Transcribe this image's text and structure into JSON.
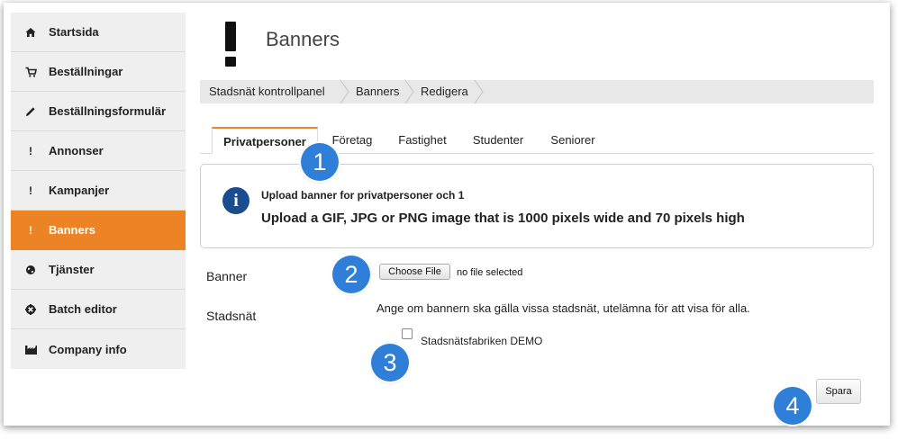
{
  "sidebar": {
    "items": [
      {
        "label": "Startsida",
        "icon": "home-icon"
      },
      {
        "label": "Beställningar",
        "icon": "cart-icon"
      },
      {
        "label": "Beställningsformulär",
        "icon": "pencil-icon"
      },
      {
        "label": "Annonser",
        "icon": "exclamation-icon"
      },
      {
        "label": "Kampanjer",
        "icon": "exclamation-icon"
      },
      {
        "label": "Banners",
        "icon": "exclamation-icon",
        "active": true
      },
      {
        "label": "Tjänster",
        "icon": "globe-icon"
      },
      {
        "label": "Batch editor",
        "icon": "gear-icon"
      },
      {
        "label": "Company info",
        "icon": "factory-icon"
      }
    ]
  },
  "header": {
    "title": "Banners",
    "icon": "exclamation-icon"
  },
  "breadcrumb": [
    "Stadsnät kontrollpanel",
    "Banners",
    "Redigera"
  ],
  "tabs": [
    {
      "label": "Privatpersoner",
      "active": true
    },
    {
      "label": "Företag"
    },
    {
      "label": "Fastighet"
    },
    {
      "label": "Studenter"
    },
    {
      "label": "Seniorer"
    }
  ],
  "info": {
    "icon": "info-icon",
    "title": "Upload banner for privatpersoner och 1",
    "text": "Upload a GIF, JPG or PNG image that is 1000 pixels wide and 70 pixels high"
  },
  "form": {
    "banner_label": "Banner",
    "choose_file_label": "Choose File",
    "file_status": "no file selected",
    "stadsnat_label": "Stadsnät",
    "stadsnat_help": "Ange om bannern ska gälla vissa stadsnät, utelämna för att visa för alla.",
    "checkbox_label": "Stadsnätsfabriken DEMO",
    "checkbox_checked": false,
    "save_label": "Spara"
  },
  "callouts": [
    "1",
    "2",
    "3",
    "4"
  ],
  "colors": {
    "accent": "#ec8324",
    "callout": "#2f7fd9",
    "info_icon": "#1a4d8f"
  }
}
